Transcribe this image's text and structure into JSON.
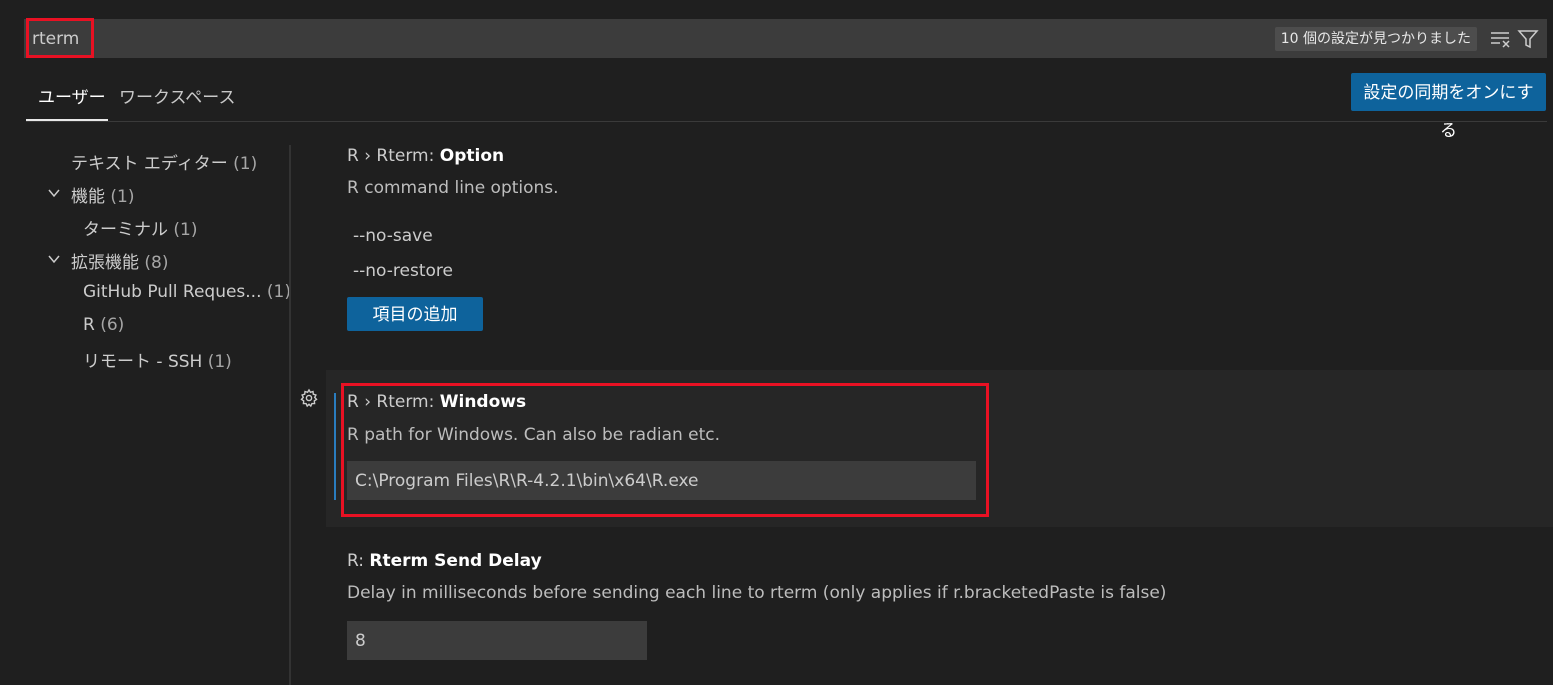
{
  "search": {
    "value": "rterm",
    "result_count": "10 個の設定が見つかりました",
    "clear_icon": "clear-filter-icon",
    "filter_icon": "filter-icon"
  },
  "tabs": {
    "user": "ユーザー",
    "workspace": "ワークスペース"
  },
  "sync_button": "設定の同期をオンにする",
  "toc": [
    {
      "label": "テキスト エディター",
      "count": "(1)"
    },
    {
      "label": "機能",
      "count": "(1)",
      "expanded": true
    },
    {
      "label": "ターミナル",
      "count": "(1)"
    },
    {
      "label": "拡張機能",
      "count": "(8)",
      "expanded": true
    },
    {
      "label": "GitHub Pull Reques...",
      "count": "(1)"
    },
    {
      "label": "R",
      "count": "(6)"
    },
    {
      "label": "リモート - SSH",
      "count": "(1)"
    }
  ],
  "settings": {
    "option": {
      "prefix": "R › Rterm: ",
      "name": "Option",
      "description": "R command line options.",
      "items": [
        "--no-save",
        "--no-restore"
      ],
      "add_button": "項目の追加"
    },
    "windows": {
      "prefix": "R › Rterm: ",
      "name": "Windows",
      "description": "R path for Windows. Can also be radian etc.",
      "value": "C:\\Program Files\\R\\R-4.2.1\\bin\\x64\\R.exe"
    },
    "send_delay": {
      "prefix": "R: ",
      "name": "Rterm Send Delay",
      "description": "Delay in milliseconds before sending each line to rterm (only applies if r.bracketedPaste is false)",
      "value": "8"
    }
  },
  "colors": {
    "background": "#1f1f1f",
    "accent": "#0e639c",
    "highlight": "#e81123"
  }
}
